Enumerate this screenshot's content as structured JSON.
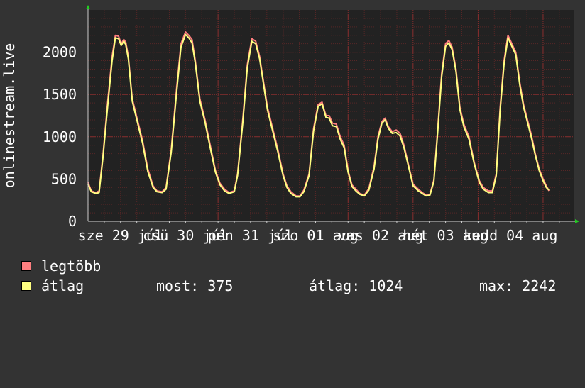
{
  "chart_data": {
    "type": "line",
    "ylabel": "onlinestream.live",
    "ylim": [
      0,
      2500
    ],
    "yticks": [
      0,
      500,
      1000,
      1500,
      2000
    ],
    "x_tick_labels": [
      "sze 29 júl",
      "csü 30 júl",
      "pén 31 júl",
      "szo 01 aug",
      "vas 02 aug",
      "hét 03 aug",
      "kedd 04 aug"
    ],
    "grid": true,
    "legend_placement": "bottom-left",
    "colors": {
      "background": "#333333",
      "plot_area": "#222222",
      "grid": "#7a2a2a",
      "axis": "#cccccc",
      "legtobb": "#ff7f80",
      "atlag": "#ffff80"
    },
    "x_unit": "day",
    "x_range": [
      0,
      7.47
    ],
    "series": [
      {
        "name": "legtöbb",
        "color": "#ff7f80",
        "points": [
          [
            0.0,
            460
          ],
          [
            0.05,
            360
          ],
          [
            0.12,
            340
          ],
          [
            0.17,
            360
          ],
          [
            0.23,
            790
          ],
          [
            0.3,
            1400
          ],
          [
            0.37,
            1950
          ],
          [
            0.42,
            2200
          ],
          [
            0.47,
            2190
          ],
          [
            0.51,
            2100
          ],
          [
            0.55,
            2150
          ],
          [
            0.58,
            2120
          ],
          [
            0.62,
            1950
          ],
          [
            0.68,
            1450
          ],
          [
            0.76,
            1200
          ],
          [
            0.84,
            950
          ],
          [
            0.92,
            620
          ],
          [
            1.0,
            420
          ],
          [
            1.06,
            360
          ],
          [
            1.14,
            350
          ],
          [
            1.2,
            400
          ],
          [
            1.28,
            850
          ],
          [
            1.36,
            1550
          ],
          [
            1.43,
            2100
          ],
          [
            1.5,
            2240
          ],
          [
            1.55,
            2200
          ],
          [
            1.6,
            2150
          ],
          [
            1.65,
            1900
          ],
          [
            1.72,
            1450
          ],
          [
            1.8,
            1200
          ],
          [
            1.88,
            900
          ],
          [
            1.96,
            600
          ],
          [
            2.03,
            450
          ],
          [
            2.1,
            380
          ],
          [
            2.17,
            340
          ],
          [
            2.25,
            360
          ],
          [
            2.3,
            560
          ],
          [
            2.38,
            1200
          ],
          [
            2.45,
            1850
          ],
          [
            2.52,
            2160
          ],
          [
            2.58,
            2130
          ],
          [
            2.64,
            1950
          ],
          [
            2.7,
            1650
          ],
          [
            2.76,
            1350
          ],
          [
            2.84,
            1100
          ],
          [
            2.92,
            850
          ],
          [
            3.0,
            560
          ],
          [
            3.06,
            420
          ],
          [
            3.12,
            350
          ],
          [
            3.2,
            300
          ],
          [
            3.26,
            300
          ],
          [
            3.32,
            370
          ],
          [
            3.4,
            560
          ],
          [
            3.47,
            1100
          ],
          [
            3.54,
            1380
          ],
          [
            3.6,
            1410
          ],
          [
            3.66,
            1250
          ],
          [
            3.71,
            1250
          ],
          [
            3.76,
            1160
          ],
          [
            3.82,
            1150
          ],
          [
            3.88,
            1000
          ],
          [
            3.94,
            900
          ],
          [
            4.0,
            600
          ],
          [
            4.06,
            430
          ],
          [
            4.12,
            380
          ],
          [
            4.18,
            330
          ],
          [
            4.25,
            310
          ],
          [
            4.32,
            390
          ],
          [
            4.4,
            650
          ],
          [
            4.46,
            1000
          ],
          [
            4.52,
            1180
          ],
          [
            4.57,
            1220
          ],
          [
            4.62,
            1120
          ],
          [
            4.68,
            1060
          ],
          [
            4.74,
            1080
          ],
          [
            4.8,
            1040
          ],
          [
            4.86,
            900
          ],
          [
            4.92,
            700
          ],
          [
            5.0,
            440
          ],
          [
            5.08,
            380
          ],
          [
            5.14,
            340
          ],
          [
            5.2,
            310
          ],
          [
            5.26,
            320
          ],
          [
            5.32,
            490
          ],
          [
            5.38,
            1100
          ],
          [
            5.44,
            1750
          ],
          [
            5.5,
            2100
          ],
          [
            5.55,
            2140
          ],
          [
            5.6,
            2060
          ],
          [
            5.66,
            1800
          ],
          [
            5.72,
            1350
          ],
          [
            5.78,
            1150
          ],
          [
            5.86,
            1000
          ],
          [
            5.94,
            700
          ],
          [
            6.02,
            480
          ],
          [
            6.08,
            400
          ],
          [
            6.16,
            360
          ],
          [
            6.22,
            360
          ],
          [
            6.28,
            560
          ],
          [
            6.34,
            1350
          ],
          [
            6.4,
            1900
          ],
          [
            6.46,
            2200
          ],
          [
            6.52,
            2100
          ],
          [
            6.58,
            2000
          ],
          [
            6.64,
            1650
          ],
          [
            6.7,
            1380
          ],
          [
            6.76,
            1200
          ],
          [
            6.82,
            1020
          ],
          [
            6.88,
            800
          ],
          [
            6.94,
            620
          ],
          [
            7.0,
            500
          ],
          [
            7.05,
            420
          ],
          [
            7.09,
            360
          ]
        ]
      },
      {
        "name": "átlag",
        "color": "#ffff80",
        "points": [
          [
            0.0,
            440
          ],
          [
            0.05,
            350
          ],
          [
            0.12,
            330
          ],
          [
            0.17,
            340
          ],
          [
            0.23,
            760
          ],
          [
            0.3,
            1350
          ],
          [
            0.37,
            1900
          ],
          [
            0.42,
            2170
          ],
          [
            0.47,
            2160
          ],
          [
            0.51,
            2080
          ],
          [
            0.55,
            2130
          ],
          [
            0.58,
            2090
          ],
          [
            0.62,
            1920
          ],
          [
            0.68,
            1420
          ],
          [
            0.76,
            1170
          ],
          [
            0.84,
            920
          ],
          [
            0.92,
            590
          ],
          [
            1.0,
            400
          ],
          [
            1.06,
            350
          ],
          [
            1.14,
            340
          ],
          [
            1.2,
            380
          ],
          [
            1.28,
            820
          ],
          [
            1.36,
            1500
          ],
          [
            1.43,
            2060
          ],
          [
            1.5,
            2210
          ],
          [
            1.55,
            2170
          ],
          [
            1.6,
            2110
          ],
          [
            1.65,
            1870
          ],
          [
            1.72,
            1420
          ],
          [
            1.8,
            1170
          ],
          [
            1.88,
            870
          ],
          [
            1.96,
            580
          ],
          [
            2.03,
            430
          ],
          [
            2.1,
            360
          ],
          [
            2.17,
            330
          ],
          [
            2.25,
            350
          ],
          [
            2.3,
            540
          ],
          [
            2.38,
            1160
          ],
          [
            2.45,
            1810
          ],
          [
            2.52,
            2130
          ],
          [
            2.58,
            2100
          ],
          [
            2.64,
            1920
          ],
          [
            2.7,
            1620
          ],
          [
            2.76,
            1320
          ],
          [
            2.84,
            1070
          ],
          [
            2.92,
            820
          ],
          [
            3.0,
            540
          ],
          [
            3.06,
            400
          ],
          [
            3.12,
            330
          ],
          [
            3.2,
            290
          ],
          [
            3.26,
            290
          ],
          [
            3.32,
            350
          ],
          [
            3.4,
            540
          ],
          [
            3.47,
            1070
          ],
          [
            3.54,
            1360
          ],
          [
            3.6,
            1390
          ],
          [
            3.66,
            1230
          ],
          [
            3.71,
            1220
          ],
          [
            3.76,
            1130
          ],
          [
            3.82,
            1120
          ],
          [
            3.88,
            970
          ],
          [
            3.94,
            870
          ],
          [
            4.0,
            580
          ],
          [
            4.06,
            410
          ],
          [
            4.12,
            360
          ],
          [
            4.18,
            320
          ],
          [
            4.25,
            300
          ],
          [
            4.32,
            370
          ],
          [
            4.4,
            620
          ],
          [
            4.46,
            970
          ],
          [
            4.52,
            1160
          ],
          [
            4.57,
            1200
          ],
          [
            4.62,
            1100
          ],
          [
            4.68,
            1040
          ],
          [
            4.74,
            1050
          ],
          [
            4.8,
            1010
          ],
          [
            4.86,
            870
          ],
          [
            4.92,
            680
          ],
          [
            5.0,
            420
          ],
          [
            5.08,
            360
          ],
          [
            5.14,
            330
          ],
          [
            5.2,
            300
          ],
          [
            5.26,
            310
          ],
          [
            5.32,
            470
          ],
          [
            5.38,
            1060
          ],
          [
            5.44,
            1710
          ],
          [
            5.5,
            2070
          ],
          [
            5.55,
            2110
          ],
          [
            5.6,
            2030
          ],
          [
            5.66,
            1770
          ],
          [
            5.72,
            1320
          ],
          [
            5.78,
            1120
          ],
          [
            5.86,
            970
          ],
          [
            5.94,
            680
          ],
          [
            6.02,
            460
          ],
          [
            6.08,
            380
          ],
          [
            6.16,
            340
          ],
          [
            6.22,
            340
          ],
          [
            6.28,
            540
          ],
          [
            6.34,
            1310
          ],
          [
            6.4,
            1860
          ],
          [
            6.46,
            2170
          ],
          [
            6.52,
            2070
          ],
          [
            6.58,
            1970
          ],
          [
            6.64,
            1620
          ],
          [
            6.7,
            1350
          ],
          [
            6.76,
            1170
          ],
          [
            6.82,
            990
          ],
          [
            6.88,
            780
          ],
          [
            6.94,
            600
          ],
          [
            7.0,
            480
          ],
          [
            7.05,
            400
          ],
          [
            7.09,
            370
          ]
        ]
      }
    ],
    "legend": [
      {
        "label": "legtöbb",
        "color": "#ff7f80"
      },
      {
        "label": "átlag",
        "color": "#ffff80"
      }
    ],
    "stats": {
      "most": "most: 375",
      "atlag": "átlag: 1024",
      "max": "max: 2242"
    }
  }
}
